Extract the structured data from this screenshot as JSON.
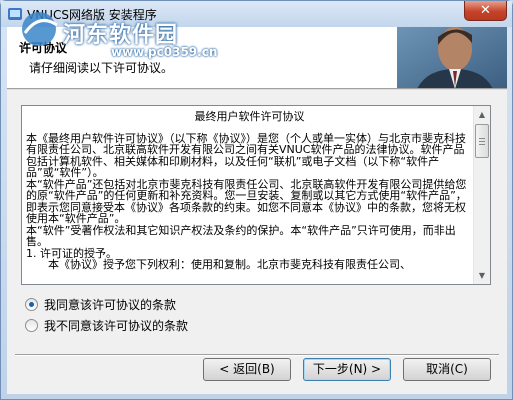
{
  "window": {
    "title": "VNUCS网络版 安装程序",
    "close_label": "✕"
  },
  "watermark": {
    "site": "河东软件园",
    "url": "www.pc0359.cn"
  },
  "header": {
    "title": "许可协议",
    "subtitle": "请仔细阅读以下许可协议。"
  },
  "license": {
    "title": "最终用户软件许可协议",
    "paragraphs": [
      "本《最终用户软件许可协议》（以下称《协议》）是您（个人或单一实体）与北京市斐克科技有限责任公司、北京联高软件开发有限公司之间有关VNUC软件产品的法律协议。软件产品包括计算机软件、相关媒体和印刷材料，以及任何“联机”或电子文档（以下称“软件产品”或“软件”）。",
      "本“软件产品”还包括对北京市斐克科技有限责任公司、北京联高软件开发有限公司提供给您的原“软件产品”的任何更新和补充资料。您一旦安装、复制或以其它方式使用“软件产品”，即表示您同意接受本《协议》各项条款的约束。如您不同意本《协议》中的条款，您将无权使用本“软件产品”。",
      "本“软件”受著作权法和其它知识产权法及条约的保护。本“软件产品”只许可使用，而非出售。",
      "1. 许可证的授予。",
      "本《协议》授予您下列权利：使用和复制。北京市斐克科技有限责任公司、"
    ]
  },
  "options": {
    "accept": "我同意该许可协议的条款",
    "decline": "我不同意该许可协议的条款",
    "selected": "accept"
  },
  "buttons": {
    "back": "< 返回(B)",
    "next": "下一步(N) >",
    "cancel": "取消(C)"
  }
}
